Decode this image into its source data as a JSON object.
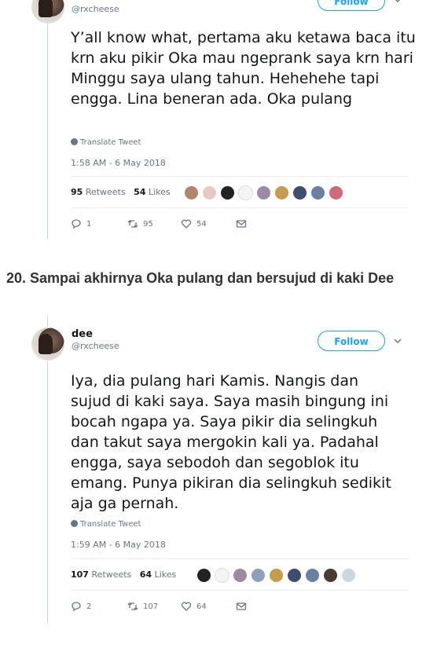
{
  "tweet1": {
    "handle": "@rxcheese",
    "follow_label": "Follow",
    "text": "Y’all know what, pertama aku ketawa baca itu krn aku pikir Oka mau ngeprank saya krn hari Minggu saya ulang tahun. Hehehehe tapi engga. Lina beneran ada. Oka pulang",
    "translate_label": "Translate Tweet",
    "timestamp": "1:58 AM - 6 May 2018",
    "retweets_count": "95",
    "retweets_label": "Retweets",
    "likes_count": "54",
    "likes_label": "Likes",
    "reply_count": "1",
    "retweet_action_count": "95",
    "like_action_count": "54"
  },
  "section_heading": "20. Sampai akhirnya Oka pulang dan bersujud di kaki Dee",
  "tweet2": {
    "name": "dee",
    "handle": "@rxcheese",
    "follow_label": "Follow",
    "text": "Iya, dia pulang hari Kamis. Nangis dan sujud di kaki saya. Saya masih bingung ini bocah ngapa ya. Saya pikir dia selingkuh dan takut saya mergokin kali ya. Padahal engga, saya sebodoh dan segoblok itu emang. Punya pikiran dia selingkuh sedikit aja ga pernah.",
    "translate_label": "Translate Tweet",
    "timestamp": "1:59 AM - 6 May 2018",
    "retweets_count": "107",
    "retweets_label": "Retweets",
    "likes_count": "64",
    "likes_label": "Likes",
    "reply_count": "2",
    "retweet_action_count": "107",
    "like_action_count": "64"
  },
  "colors": {
    "accent": "#1da1f2",
    "muted": "#657786",
    "text": "#14171a"
  },
  "icons": [
    "chevron-down-icon",
    "globe-icon",
    "reply-icon",
    "retweet-icon",
    "like-icon",
    "message-icon",
    "avatar"
  ]
}
